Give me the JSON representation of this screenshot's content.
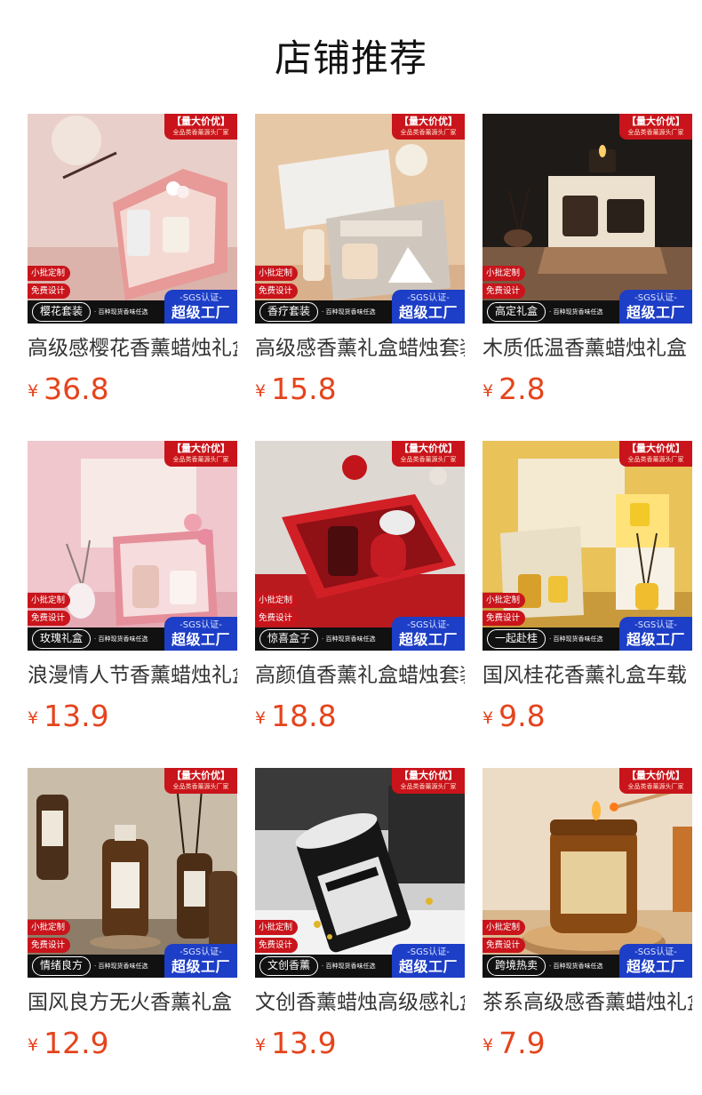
{
  "page": {
    "title": "店铺推荐"
  },
  "badges": {
    "promo_title": "【量大价优】",
    "promo_sub": "全品类香薰源头厂家",
    "tag_custom": "小批定制",
    "tag_design": "免费设计",
    "pitch": "· 百种现货香味任选",
    "sgs_top": "-SGS认证-",
    "sgs_main": "超级工厂"
  },
  "currency": "¥",
  "colors": {
    "price": "#e5441d",
    "badge_red": "#c9141b",
    "badge_blue": "#1d3ec6"
  },
  "products": [
    {
      "name": "高级感樱花香薰蜡烛礼盒",
      "price": "36.8",
      "series": "樱花套装",
      "scene": "sakura-gift-box"
    },
    {
      "name": "高级感香薰礼盒蜡烛套装",
      "price": "15.8",
      "series": "香疗套装",
      "scene": "perfumed-box"
    },
    {
      "name": "木质低温香薰蜡烛礼盒",
      "price": "2.8",
      "series": "高定礼盒",
      "scene": "wood-box"
    },
    {
      "name": "浪漫情人节香薰蜡烛礼盒",
      "price": "13.9",
      "series": "玫瑰礼盒",
      "scene": "rose-box"
    },
    {
      "name": "高颜值香薰礼盒蜡烛套装",
      "price": "18.8",
      "series": "惊喜盒子",
      "scene": "red-box"
    },
    {
      "name": "国风桂花香薰礼盒车载",
      "price": "9.8",
      "series": "一起赴桂",
      "scene": "osmanthus-box"
    },
    {
      "name": "国风良方无火香薰礼盒",
      "price": "12.9",
      "series": "情绪良方",
      "scene": "amber-bottles"
    },
    {
      "name": "文创香薰蜡烛高级感礼盒",
      "price": "13.9",
      "series": "文创香薰",
      "scene": "black-candle"
    },
    {
      "name": "茶系高级感香薰蜡烛礼盒",
      "price": "7.9",
      "series": "跨境热卖",
      "scene": "amber-jar"
    }
  ]
}
